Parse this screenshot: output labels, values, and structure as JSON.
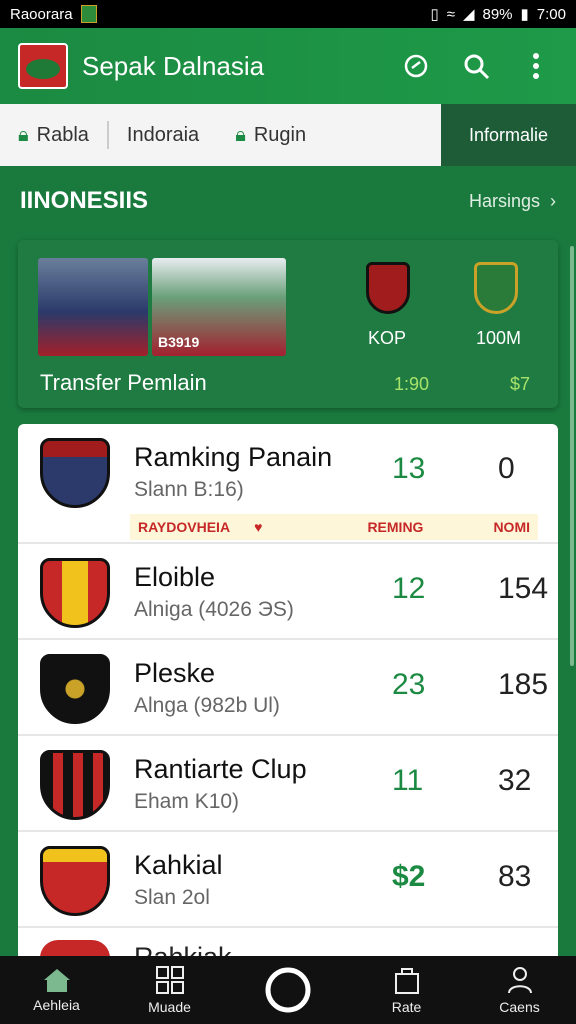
{
  "status": {
    "carrier": "Raoorara",
    "battery": "89%",
    "time": "7:00"
  },
  "app": {
    "title": "Sepak Dalnasia"
  },
  "tabs": [
    "Rabla",
    "Indoraia",
    "Rugin",
    "Informalie"
  ],
  "section": {
    "title": "IINONESIIS",
    "more": "Harsings"
  },
  "hero": {
    "photo1_caption": "",
    "photo2_caption": "B3919",
    "team_codes": [
      "KOP",
      "100M"
    ],
    "label": "Transfer Pemlain",
    "values": [
      "1:90",
      "$7"
    ]
  },
  "list": {
    "rows": [
      {
        "name": "Ramking Panain",
        "sub": "Slann B:16)",
        "n1": "13",
        "n2": "0"
      },
      {
        "name": "Eloible",
        "sub": "Alniga (4026 ЭS)",
        "n1": "12",
        "n2": "154"
      },
      {
        "name": "Pleske",
        "sub": "Alnga (982b Ul)",
        "n1": "23",
        "n2": "185"
      },
      {
        "name": "Rantiarte Clup",
        "sub": "Eham K10)",
        "n1": "11",
        "n2": "32"
      },
      {
        "name": "Kahkial",
        "sub": "Slan 2ol",
        "n1": "$2",
        "n2": "83"
      }
    ],
    "strip": {
      "left": "RAYDOVHEIA",
      "mid": "REMING",
      "right": "NOMI"
    },
    "peek": "Rahkiak"
  },
  "nav": [
    "Aehleia",
    "Muade",
    "",
    "Rate",
    "Caens"
  ],
  "colors": {
    "primary": "#1b8a42",
    "accent": "#c62828",
    "number_green": "#1c8a42"
  }
}
